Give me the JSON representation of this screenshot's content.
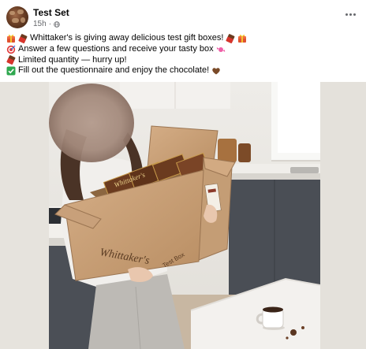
{
  "post": {
    "author": "Test Set",
    "time": "15h",
    "separator": "·",
    "lines": [
      {
        "icons": [
          "gift-icon",
          "chocolate-bar-icon"
        ],
        "text": "Whittaker's is giving away delicious test gift boxes!",
        "trailing_icons": [
          "chocolate-bar-icon",
          "gift-icon"
        ]
      },
      {
        "icons": [
          "target-icon"
        ],
        "text": "Answer a few questions and receive your tasty box",
        "trailing_icons": [
          "candy-icon"
        ]
      },
      {
        "icons": [
          "chocolate-bar-icon"
        ],
        "text": "Limited quantity — hurry up!",
        "trailing_icons": []
      },
      {
        "icons": [
          "check-box-icon"
        ],
        "text": "Fill out the questionnaire and enjoy the chocolate!",
        "trailing_icons": [
          "heart-icon"
        ]
      }
    ]
  },
  "photo": {
    "box_brand": "Whittaker's",
    "box_side_label": "Test Box",
    "bar_brand": "Whittaker's"
  },
  "colors": {
    "link_text": "#050505",
    "meta_text": "#65676b",
    "cardboard": "#c9a079",
    "chocolate_wrapper": "#6b3b1f",
    "check_box": "#2fa84f"
  }
}
